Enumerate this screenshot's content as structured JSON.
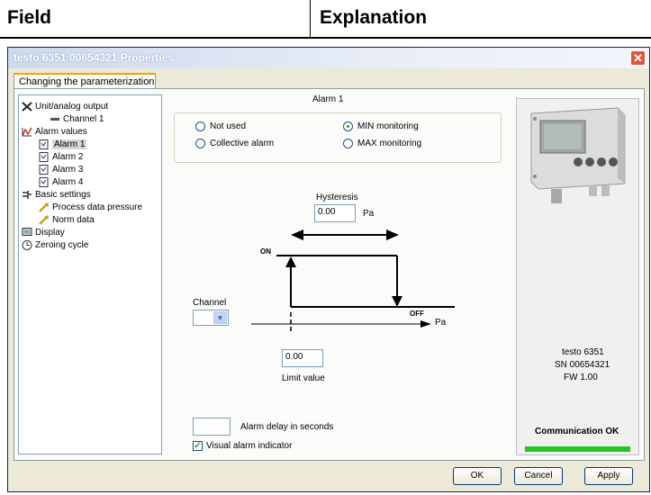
{
  "doc": {
    "col_field": "Field",
    "col_explanation": "Explanation"
  },
  "window": {
    "title": "testo 6351  00654321 Properties",
    "close_glyph": "✕"
  },
  "tab": {
    "label": "Changing the parameterization"
  },
  "tree": {
    "unit_output": "Unit/analog output",
    "channel1": "Channel 1",
    "alarm_values": "Alarm values",
    "alarm1": "Alarm 1",
    "alarm2": "Alarm 2",
    "alarm3": "Alarm 3",
    "alarm4": "Alarm 4",
    "basic_settings": "Basic settings",
    "process_data": "Process data pressure",
    "norm_data": "Norm data",
    "display": "Display",
    "zeroing": "Zeroing cycle"
  },
  "alarm": {
    "heading": "Alarm 1",
    "not_used": "Not used",
    "collective": "Collective alarm",
    "min_monitoring": "MIN monitoring",
    "max_monitoring": "MAX monitoring",
    "hysteresis_label": "Hysteresis",
    "hysteresis_value": "0.00",
    "hysteresis_unit": "Pa",
    "channel_label": "Channel",
    "on_label": "ON",
    "off_label": "OFF",
    "axis_unit": "Pa",
    "limit_value": "0.00",
    "limit_label": "Limit value",
    "delay_label": "Alarm delay in seconds",
    "delay_value": "",
    "visual_label": "Visual alarm indicator",
    "visual_checked": true
  },
  "device": {
    "model": "testo 6351",
    "serial": "SN 00654321",
    "firmware": "FW  1.00",
    "status": "Communication OK",
    "status_color": "#26c426"
  },
  "buttons": {
    "ok": "OK",
    "cancel": "Cancel",
    "apply": "Apply"
  }
}
